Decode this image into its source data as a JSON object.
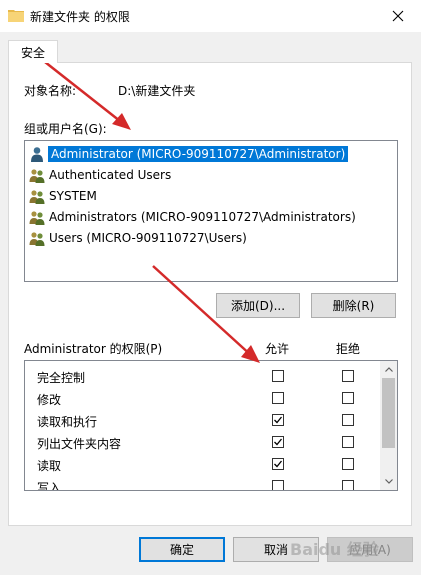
{
  "window": {
    "title": "新建文件夹 的权限"
  },
  "tabs": [
    {
      "label": "安全"
    }
  ],
  "object": {
    "label": "对象名称:",
    "value": "D:\\新建文件夹"
  },
  "group_label": "组或用户名(G):",
  "users": [
    {
      "name": "Administrator (MICRO-909110727\\Administrator)",
      "selected": true
    },
    {
      "name": "Authenticated Users",
      "selected": false
    },
    {
      "name": "SYSTEM",
      "selected": false
    },
    {
      "name": "Administrators (MICRO-909110727\\Administrators)",
      "selected": false
    },
    {
      "name": "Users (MICRO-909110727\\Users)",
      "selected": false
    }
  ],
  "buttons": {
    "add": "添加(D)...",
    "remove": "删除(R)",
    "ok": "确定",
    "cancel": "取消",
    "apply": "应用(A)"
  },
  "permissions": {
    "header": "Administrator 的权限(P)",
    "allow_label": "允许",
    "deny_label": "拒绝",
    "rows": [
      {
        "name": "完全控制",
        "allow": false,
        "deny": false
      },
      {
        "name": "修改",
        "allow": false,
        "deny": false
      },
      {
        "name": "读取和执行",
        "allow": true,
        "deny": false
      },
      {
        "name": "列出文件夹内容",
        "allow": true,
        "deny": false
      },
      {
        "name": "读取",
        "allow": true,
        "deny": false
      },
      {
        "name": "写入",
        "allow": false,
        "deny": false
      }
    ]
  },
  "watermark": "Baidu 经验",
  "colors": {
    "selection": "#0078d7",
    "annotation_arrow": "#d42a2a"
  }
}
